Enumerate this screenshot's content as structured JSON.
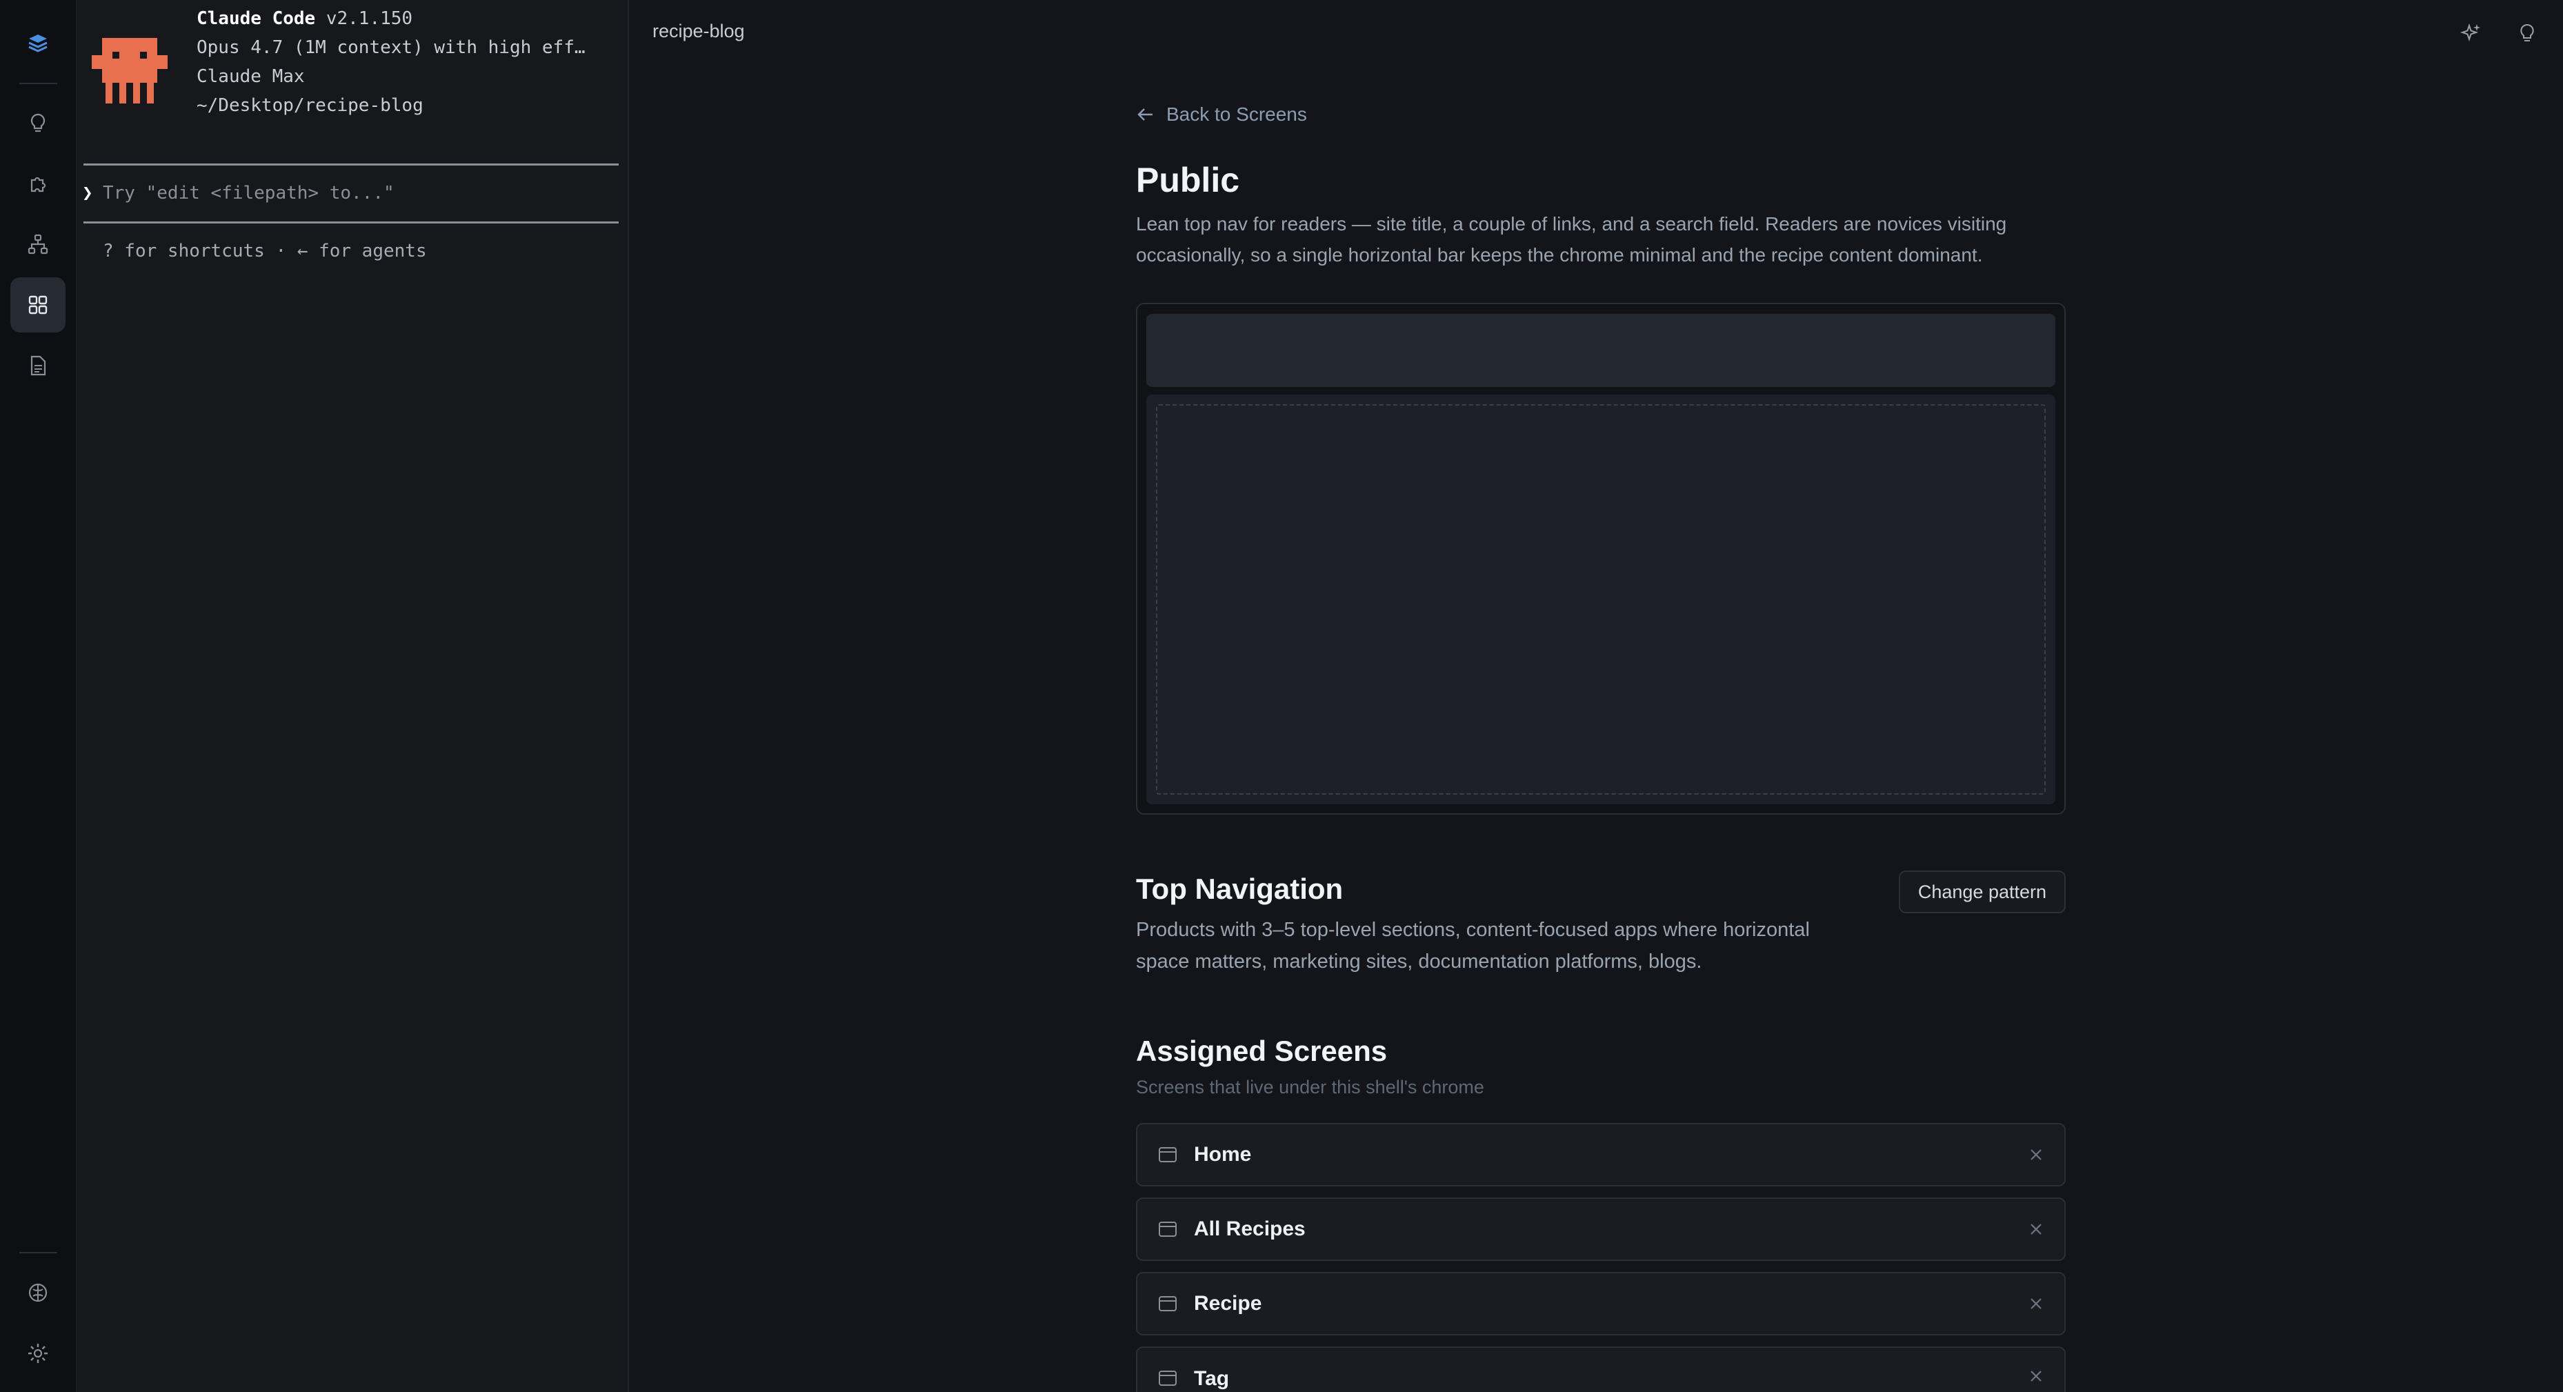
{
  "terminal": {
    "app_name": "Claude Code",
    "version": "v2.1.150",
    "model_line": "Opus 4.7 (1M context) with high eff…",
    "plan": "Claude Max",
    "cwd": "~/Desktop/recipe-blog",
    "prompt_chevron": "❯",
    "prompt_placeholder": "Try \"edit <filepath> to...\"",
    "hint": "? for shortcuts · ← for agents"
  },
  "topbar": {
    "project": "recipe-blog"
  },
  "page": {
    "back_label": "Back to Screens",
    "title": "Public",
    "description": "Lean top nav for readers — site title, a couple of links, and a search field. Readers are novices visiting occasionally, so a single horizontal bar keeps the chrome minimal and the recipe content dominant."
  },
  "pattern": {
    "title": "Top Navigation",
    "change_label": "Change pattern",
    "description": "Products with 3–5 top-level sections, content-focused apps where horizontal space matters, marketing sites, documentation platforms, blogs."
  },
  "assigned": {
    "title": "Assigned Screens",
    "subtitle": "Screens that live under this shell's chrome",
    "screens": [
      {
        "label": "Home"
      },
      {
        "label": "All Recipes"
      },
      {
        "label": "Recipe"
      },
      {
        "label": "Tag"
      }
    ]
  },
  "colors": {
    "brand_orange": "#e8704e",
    "rail_active": "#262a32",
    "link": "#8c9db3"
  }
}
